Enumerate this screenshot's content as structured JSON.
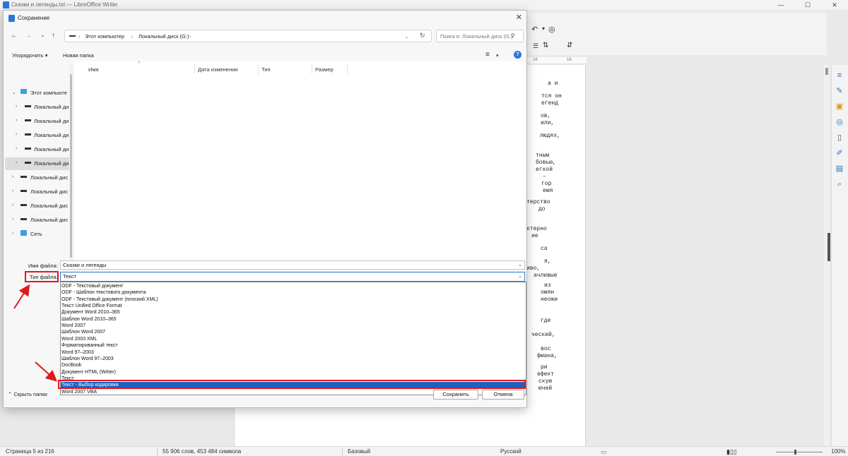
{
  "app": {
    "title": "Сказки и легенды.txt — LibreOffice Writer",
    "win_controls": [
      "—",
      "☐",
      "✕"
    ]
  },
  "toolbar_icons": [
    "↶",
    "▾",
    "◎"
  ],
  "ruler": {
    "left": "16",
    "right": "18"
  },
  "document": {
    "lines": [
      "а и",
      "тся он",
      "егенд",
      "ов,",
      "или,",
      "людях,",
      "тным",
      "бовью,",
      "егкой",
      "–",
      "гор",
      "емя",
      "терство",
      "до",
      "ктерно",
      "ие",
      "са",
      "я,",
      "иво,",
      "ачливые",
      "из",
      "омян",
      "неожи",
      "где",
      "ческий,",
      "вос",
      "фмана,",
      "ри",
      "ефект",
      "скую",
      "ючей"
    ]
  },
  "sidebar_deck": [
    "properties-icon",
    "styles-icon",
    "gallery-icon",
    "navigator-icon",
    "page-icon",
    "style-inspector-icon",
    "manage-changes-icon",
    "find-icon"
  ],
  "dialog": {
    "title": "Сохранение",
    "nav": {
      "back": "←",
      "forward": "→",
      "recent": "⌄",
      "up": "↑"
    },
    "breadcrumb": [
      "Этот компьютер",
      "Локальный диск (G:)"
    ],
    "refresh": "↻",
    "search_placeholder": "Поиск в: Локальный диск (G:)",
    "commands": {
      "organize": "Упорядочить ▾",
      "new_folder": "Новая папка"
    },
    "tree": [
      {
        "label": "Этот компьюте",
        "kind": "pc"
      },
      {
        "label": "Локальный ди",
        "kind": "drive"
      },
      {
        "label": "Локальный ди",
        "kind": "drive"
      },
      {
        "label": "Локальный ди",
        "kind": "drive"
      },
      {
        "label": "Локальный ди",
        "kind": "drive"
      },
      {
        "label": "Локальный ди",
        "kind": "drive",
        "selected": true
      },
      {
        "label": "Локальный дис",
        "kind": "drive"
      },
      {
        "label": "Локальный дис",
        "kind": "drive"
      },
      {
        "label": "Локальный дис",
        "kind": "drive"
      },
      {
        "label": "Локальный дис",
        "kind": "drive"
      },
      {
        "label": "Сеть",
        "kind": "net"
      }
    ],
    "columns": [
      "Имя",
      "Дата изменения",
      "Тип",
      "Размер"
    ],
    "filename_label": "Имя файла:",
    "filename_value": "Сказки и легенды",
    "filetype_label": "Тип файла:",
    "filetype_value": "Текст",
    "filetype_options": [
      "ODF - Текстовый документ",
      "ODF - Шаблон текстового документа",
      "ODF - Текстовый документ (плоский XML)",
      "Текст Unified Office Format",
      "Документ Word 2010–365",
      "Шаблон Word 2010–365",
      "Word 2007",
      "Шаблон Word 2007",
      "Word 2003 XML",
      "Форматированный текст",
      "Word 97–2003",
      "Шаблон Word 97–2003",
      "DocBook",
      "Документ HTML (Writer)",
      "Текст",
      "Текст - Выбор кодировки",
      "Word 2007 VBA"
    ],
    "highlighted_option": "Текст - Выбор кодировки",
    "hide_folders": "Скрыть папки",
    "save_button": "Сохранить",
    "cancel_button": "Отмена"
  },
  "status": {
    "page": "Страница 5 из 216",
    "words": "55 906 слов, 453 484 символа",
    "style": "Базовый",
    "language": "Русский",
    "zoom": "100%"
  },
  "colors": {
    "accent": "#1e5fbf",
    "annotation": "#e0191f"
  }
}
